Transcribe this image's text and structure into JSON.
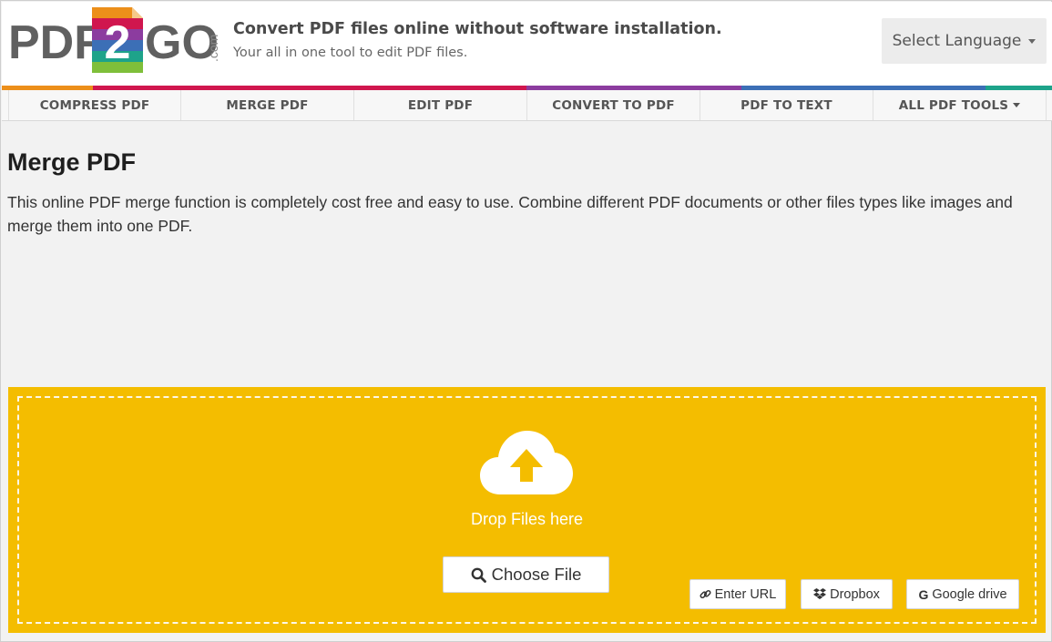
{
  "header": {
    "logo_text": {
      "left": "PDF",
      "middle": "2",
      "right": "GO",
      "suffix": ".com"
    },
    "tagline": "Convert PDF files online without software installation.",
    "subtagline": "Your all in one tool to edit PDF files.",
    "language_button": "Select Language"
  },
  "stripe_colors": [
    "#ec8f1a",
    "#d0164e",
    "#d0164e",
    "#8c3c9f",
    "#3c6fb6",
    "#1ea38a"
  ],
  "nav": {
    "items": [
      {
        "label": "COMPRESS PDF"
      },
      {
        "label": "MERGE PDF"
      },
      {
        "label": "EDIT PDF"
      },
      {
        "label": "CONVERT TO PDF"
      },
      {
        "label": "PDF TO TEXT"
      },
      {
        "label": "ALL PDF TOOLS"
      }
    ]
  },
  "main": {
    "title": "Merge PDF",
    "description": "This online PDF merge function is completely cost free and easy to use. Combine different PDF documents or other files types like images and merge them into one PDF."
  },
  "upload": {
    "drop_text": "Drop Files here",
    "choose_label": "Choose File",
    "url_label": "Enter URL",
    "dropbox_label": "Dropbox",
    "gdrive_label": "Google drive",
    "background_color": "#f4bd00",
    "icons": [
      "cloud-upload-icon",
      "search-icon",
      "link-icon",
      "dropbox-icon",
      "google-icon"
    ]
  }
}
